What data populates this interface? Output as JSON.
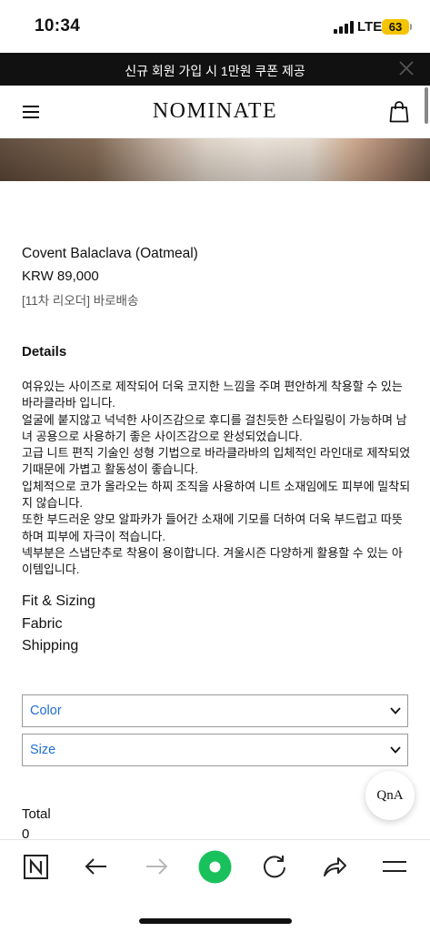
{
  "status_bar": {
    "time": "10:34",
    "network": "LTE",
    "battery": "63",
    "battery_color": "#f5c400"
  },
  "promo": {
    "text": "신규 회원 가입 시 1만원 쿠폰 제공",
    "close_icon": "close-icon"
  },
  "header": {
    "logo": "NOMINATE",
    "menu_icon": "hamburger-menu-icon",
    "cart_icon": "shopping-bag-icon"
  },
  "product": {
    "name": "Covent Balaclava (Oatmeal)",
    "price": "KRW 89,000",
    "note": "[11차 리오더] 바로배송"
  },
  "details": {
    "title": "Details",
    "paragraphs": [
      "여유있는 사이즈로 제작되어 더욱 코지한 느낌을 주며 편안하게 착용할 수 있는 바라클라바 입니다.",
      "얼굴에 붙지않고 넉넉한 사이즈감으로 후디를 걸친듯한 스타일링이 가능하며 남녀 공용으로 사용하기 좋은 사이즈감으로 완성되었습니다.",
      "고급 니트 편직 기술인 성형 기법으로 바라클라바의 입체적인 라인대로 제작되었기때문에 가볍고 활동성이 좋습니다.",
      "입체적으로 코가 올라오는 하찌 조직을 사용하여 니트 소재임에도 피부에 밀착되지 않습니다.",
      "또한 부드러운 양모 알파카가 들어간 소재에 기모를 더하여 더욱 부드럽고 따뜻하며 피부에 자극이 적습니다.",
      "넥부분은 스냅단추로 착용이 용이합니다. 겨울시즌 다양하게 활용할 수 있는 아이템입니다."
    ]
  },
  "info_links": [
    "Fit & Sizing",
    "Fabric",
    "Shipping"
  ],
  "options": {
    "color_label": "Color",
    "size_label": "Size",
    "label_color": "#1f6fd1"
  },
  "qna": {
    "label": "QnA"
  },
  "total": {
    "label": "Total",
    "value": "0"
  },
  "toolbar": {
    "buttons": [
      "naver-n-icon",
      "back-arrow-icon",
      "forward-arrow-icon",
      "green-dot-icon",
      "refresh-icon",
      "share-icon",
      "menu-lines-icon"
    ],
    "accent": "#19c15c"
  }
}
